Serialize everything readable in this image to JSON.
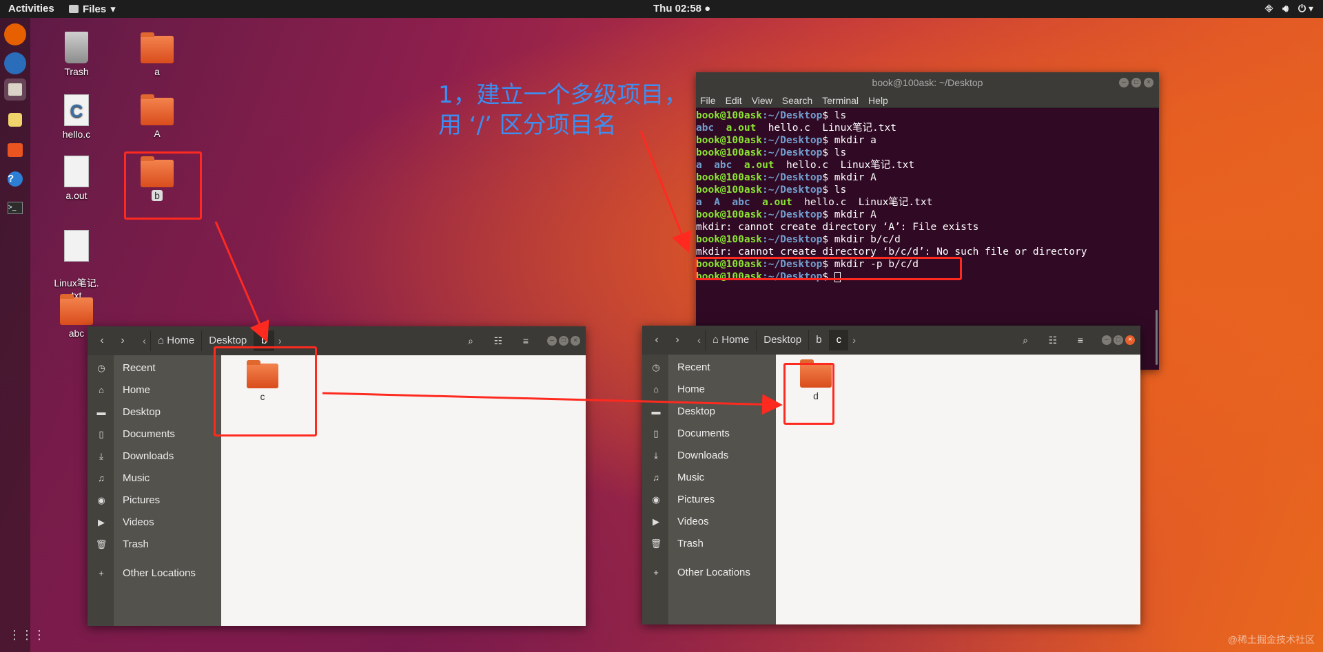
{
  "topbar": {
    "activities": "Activities",
    "app_menu": "Files",
    "clock": "Thu 02:58 ●"
  },
  "desktop": {
    "icons": [
      {
        "label": "Trash"
      },
      {
        "label": "a"
      },
      {
        "label": "hello.c"
      },
      {
        "label": "A"
      },
      {
        "label": "a.out"
      },
      {
        "label": "b"
      },
      {
        "label": "Linux笔记.\ntxt"
      },
      {
        "label": "abc"
      }
    ]
  },
  "annotation": {
    "line1": "1，建立一个多级项目，",
    "line2": "用 ‘/’ 区分项目名"
  },
  "terminal": {
    "title": "book@100ask: ~/Desktop",
    "menu": [
      "File",
      "Edit",
      "View",
      "Search",
      "Terminal",
      "Help"
    ],
    "prompt_user": "book@100ask",
    "prompt_path": ":~/Desktop",
    "lines": [
      {
        "type": "cmd",
        "text": "ls"
      },
      {
        "type": "ls",
        "items": [
          {
            "t": "abc",
            "k": "d"
          },
          {
            "t": "a.out",
            "k": "x"
          },
          {
            "t": "hello.c",
            "k": "f"
          },
          {
            "t": "Linux笔记.txt",
            "k": "f"
          }
        ]
      },
      {
        "type": "cmd",
        "text": "mkdir a"
      },
      {
        "type": "cmd",
        "text": "ls"
      },
      {
        "type": "ls",
        "items": [
          {
            "t": "a",
            "k": "d"
          },
          {
            "t": "abc",
            "k": "d"
          },
          {
            "t": "a.out",
            "k": "x"
          },
          {
            "t": "hello.c",
            "k": "f"
          },
          {
            "t": "Linux笔记.txt",
            "k": "f"
          }
        ]
      },
      {
        "type": "cmd",
        "text": "mkdir A"
      },
      {
        "type": "cmd",
        "text": "ls"
      },
      {
        "type": "ls",
        "items": [
          {
            "t": "a",
            "k": "d"
          },
          {
            "t": "A",
            "k": "d"
          },
          {
            "t": "abc",
            "k": "d"
          },
          {
            "t": "a.out",
            "k": "x"
          },
          {
            "t": "hello.c",
            "k": "f"
          },
          {
            "t": "Linux笔记.txt",
            "k": "f"
          }
        ]
      },
      {
        "type": "cmd",
        "text": "mkdir A"
      },
      {
        "type": "out",
        "text": "mkdir: cannot create directory ‘A’: File exists"
      },
      {
        "type": "cmd",
        "text": "mkdir b/c/d"
      },
      {
        "type": "out",
        "text": "mkdir: cannot create directory ‘b/c/d’: No such file or directory"
      },
      {
        "type": "cmd",
        "text": "mkdir -p b/c/d"
      },
      {
        "type": "cursor"
      }
    ]
  },
  "fm_left": {
    "crumbs": [
      "Home",
      "Desktop",
      "b"
    ],
    "active_crumb": "b",
    "files": [
      "c"
    ]
  },
  "fm_right": {
    "crumbs": [
      "Home",
      "Desktop",
      "b",
      "c"
    ],
    "active_crumb": "c",
    "files": [
      "d"
    ]
  },
  "sidebar": {
    "items": [
      {
        "label": "Recent",
        "icon": "clock-icon"
      },
      {
        "label": "Home",
        "icon": "home-icon"
      },
      {
        "label": "Desktop",
        "icon": "desktop-folder-icon"
      },
      {
        "label": "Documents",
        "icon": "document-icon"
      },
      {
        "label": "Downloads",
        "icon": "download-icon"
      },
      {
        "label": "Music",
        "icon": "music-icon"
      },
      {
        "label": "Pictures",
        "icon": "camera-icon"
      },
      {
        "label": "Videos",
        "icon": "video-icon"
      },
      {
        "label": "Trash",
        "icon": "trash-icon"
      }
    ],
    "other": "Other Locations"
  },
  "watermark": "@稀土掘金技术社区",
  "colors": {
    "annotation_red": "#ff2a1f",
    "annotation_blue": "#3d8ef0",
    "terminal_bg": "#300a24"
  }
}
